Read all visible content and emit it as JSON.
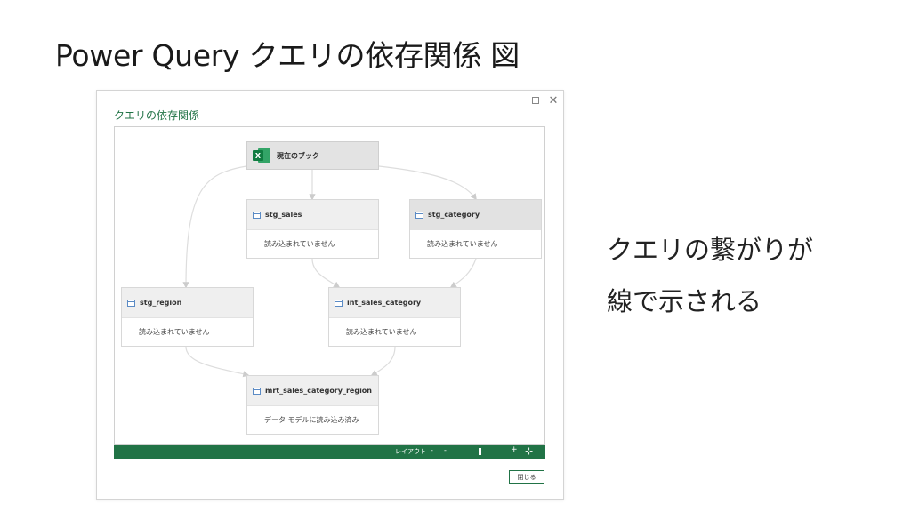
{
  "slide": {
    "title": "Power Query クエリの依存関係 図",
    "caption_line1": "クエリの繋がりが",
    "caption_line2": "線で示される"
  },
  "dialog": {
    "title": "クエリの依存関係",
    "maximize_icon": "maximize-icon",
    "close_icon": "close-icon",
    "close_glyph": "✕",
    "close_button_label": "閉じる"
  },
  "graph": {
    "workbook": {
      "label": "現在のブック",
      "icon": "excel-icon",
      "icon_letter": "X"
    },
    "nodes": [
      {
        "name": "stg_sales",
        "status": "読み込まれていません"
      },
      {
        "name": "stg_category",
        "status": "読み込まれていません"
      },
      {
        "name": "stg_region",
        "status": "読み込まれていません"
      },
      {
        "name": "int_sales_category",
        "status": "読み込まれていません"
      },
      {
        "name": "mrt_sales_category_region",
        "status": "データ モデルに読み込み済み"
      }
    ]
  },
  "statusbar": {
    "layout_label": "レイアウト",
    "zoom_out": "-",
    "zoom_out_2": "-",
    "zoom_in": "+",
    "fit_glyph": "⊹",
    "accent_color": "#217346"
  }
}
